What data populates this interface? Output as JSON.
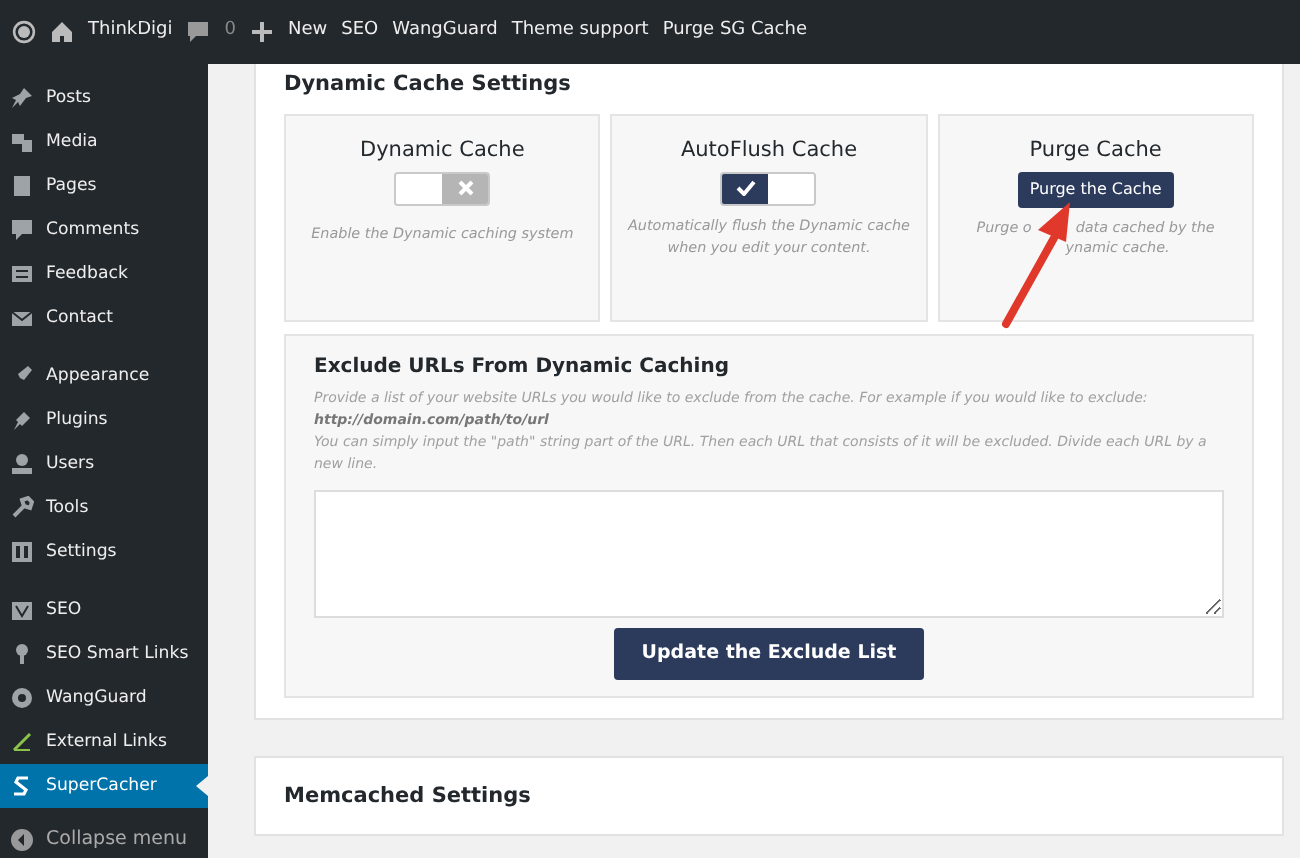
{
  "top_bar": {
    "site": "ThinkDigi",
    "comments": "0",
    "new": "New",
    "links": [
      "SEO",
      "WangGuard",
      "Theme support",
      "Purge SG Cache"
    ]
  },
  "sidebar": {
    "groups": [
      [
        {
          "label": "Posts",
          "selected": false
        },
        {
          "label": "Media",
          "selected": false
        },
        {
          "label": "Pages",
          "selected": false
        },
        {
          "label": "Comments",
          "selected": false
        },
        {
          "label": "Feedback",
          "selected": false
        },
        {
          "label": "Contact",
          "selected": false
        }
      ],
      [
        {
          "label": "Appearance",
          "selected": false
        },
        {
          "label": "Plugins",
          "selected": false
        },
        {
          "label": "Users",
          "selected": false
        },
        {
          "label": "Tools",
          "selected": false
        },
        {
          "label": "Settings",
          "selected": false
        }
      ],
      [
        {
          "label": "SEO",
          "selected": false
        },
        {
          "label": "SEO Smart Links",
          "selected": false
        },
        {
          "label": "WangGuard",
          "selected": false
        },
        {
          "label": "External Links",
          "selected": false
        },
        {
          "label": "SuperCacher",
          "selected": true
        }
      ]
    ],
    "collapse": "Collapse menu"
  },
  "dynamic_cache_settings": {
    "title": "Dynamic Cache Settings",
    "cards": [
      {
        "kind": "toggle",
        "title": "Dynamic Cache",
        "on": false,
        "description": "Enable the Dynamic caching system"
      },
      {
        "kind": "toggle",
        "title": "AutoFlush Cache",
        "on": true,
        "description": "Automatically flush the Dynamic cache when you edit your content."
      },
      {
        "kind": "button",
        "title": "Purge Cache",
        "button": "Purge the Cache",
        "description_lines": [
          [
            "Purge o",
            "data cached by the"
          ],
          [
            "ynamic cache."
          ]
        ]
      }
    ],
    "exclude": {
      "title": "Exclude URLs From Dynamic Caching",
      "intro": "Provide a list of your website URLs you would like to exclude from the cache. For example if you would like to exclude:",
      "example": "http://domain.com/path/to/url",
      "note": "You can simply input the \"path\" string part of the URL. Then each URL that consists of it will be excluded. Divide each URL by a new line.",
      "button": "Update the Exclude List"
    }
  },
  "memcached_settings": {
    "title": "Memcached Settings"
  }
}
